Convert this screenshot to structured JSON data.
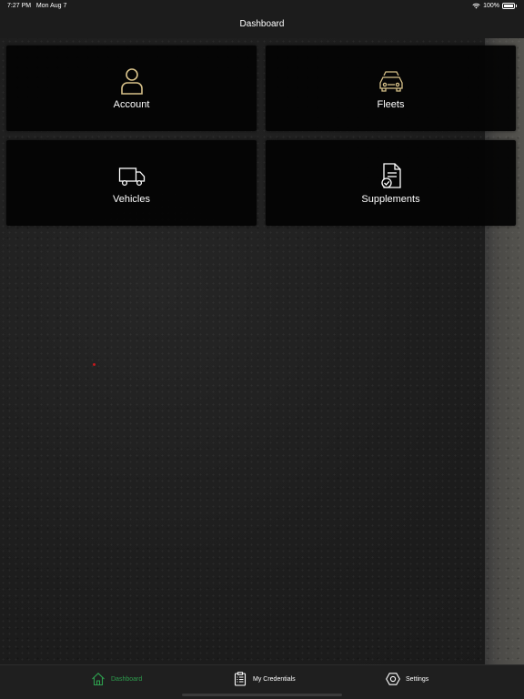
{
  "status_bar": {
    "time": "7:27 PM",
    "date": "Mon Aug 7",
    "battery": "100%"
  },
  "nav": {
    "title": "Dashboard"
  },
  "tiles": [
    {
      "label": "Account",
      "icon": "person-icon"
    },
    {
      "label": "Fleets",
      "icon": "cars-icon"
    },
    {
      "label": "Vehicles",
      "icon": "truck-icon"
    },
    {
      "label": "Supplements",
      "icon": "document-check-icon"
    }
  ],
  "tab_bar": {
    "items": [
      {
        "label": "Dashboard",
        "icon": "home-icon",
        "active": true
      },
      {
        "label": "My Credentials",
        "icon": "clipboard-icon",
        "active": false
      },
      {
        "label": "Settings",
        "icon": "hexagon-gear-icon",
        "active": false
      }
    ]
  },
  "colors": {
    "icon_gold": "#d8c28a",
    "active_tab": "#2e9e4e",
    "tile_bg": "#040404"
  }
}
